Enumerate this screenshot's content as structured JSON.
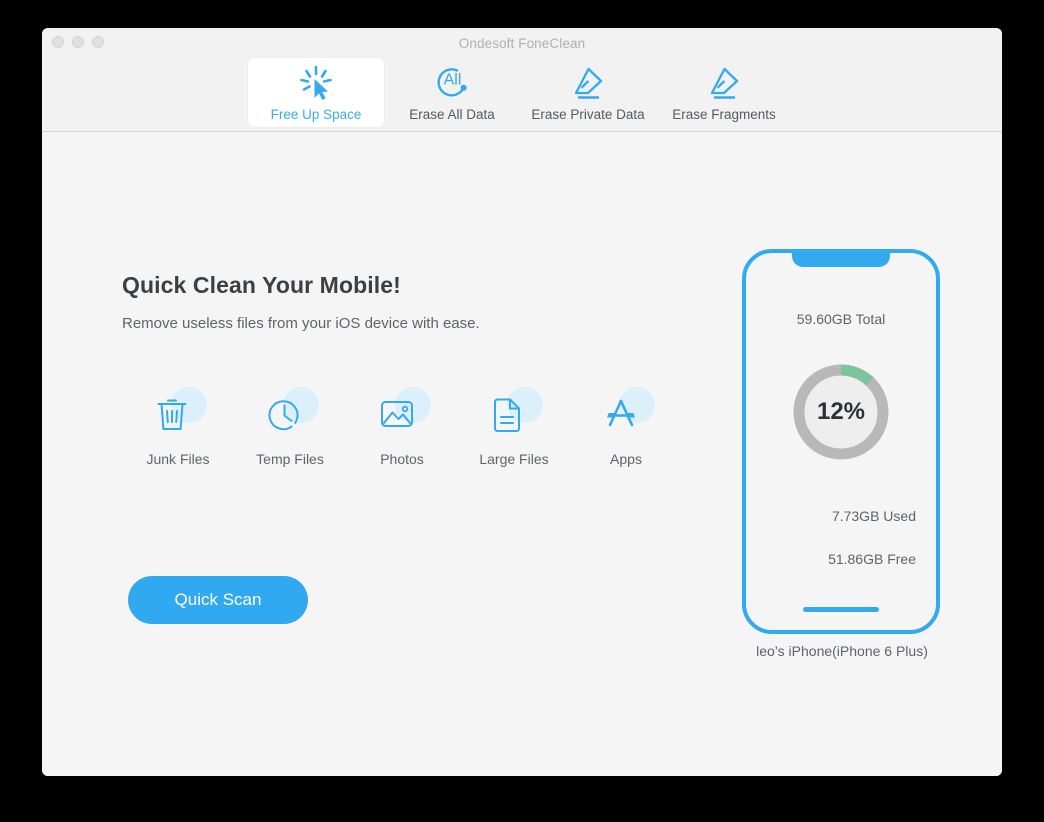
{
  "window": {
    "title": "Ondesoft FoneClean",
    "traffic_lights": [
      "close",
      "minimize",
      "zoom"
    ]
  },
  "toolbar": {
    "tabs": [
      {
        "label": "Free Up Space",
        "icon": "cursor-click-icon",
        "active": true
      },
      {
        "label": "Erase All Data",
        "icon": "all-circle-icon",
        "active": false
      },
      {
        "label": "Erase Private Data",
        "icon": "eraser-icon",
        "active": false
      },
      {
        "label": "Erase Fragments",
        "icon": "eraser-icon",
        "active": false
      }
    ]
  },
  "main": {
    "headline": "Quick Clean Your Mobile!",
    "subhead": "Remove useless files from your iOS device with ease.",
    "features": [
      {
        "label": "Junk Files",
        "icon": "trash-icon"
      },
      {
        "label": "Temp Files",
        "icon": "clock-icon"
      },
      {
        "label": "Photos",
        "icon": "photo-icon"
      },
      {
        "label": "Large Files",
        "icon": "document-icon"
      },
      {
        "label": "Apps",
        "icon": "appstore-icon"
      }
    ],
    "scan_button": "Quick Scan"
  },
  "device": {
    "total": "59.60GB Total",
    "percent_label": "12%",
    "used": "7.73GB Used",
    "free": "51.86GB Free",
    "name": "leo’s iPhone(iPhone 6 Plus)"
  },
  "chart_data": {
    "type": "pie",
    "title": "Device storage usage",
    "categories": [
      "Used",
      "Free"
    ],
    "values": [
      12,
      88
    ],
    "units": "percent",
    "labels": [
      "7.73GB Used",
      "51.86GB Free"
    ],
    "center_text": "12%",
    "total": "59.60GB Total",
    "colors": [
      "#7cc598",
      "#b8b8b8"
    ],
    "legend": "none"
  },
  "colors": {
    "accent": "#33a9f0",
    "accent_button": "#31a9f1",
    "icon_blob": "#dcf0fc",
    "donut_used": "#7cc598",
    "donut_track": "#b8b8b8",
    "toolbar_bg": "#f2f2f2",
    "body_bg": "#f5f5f5",
    "text": "#5f6368",
    "title_text": "#3c4043"
  }
}
